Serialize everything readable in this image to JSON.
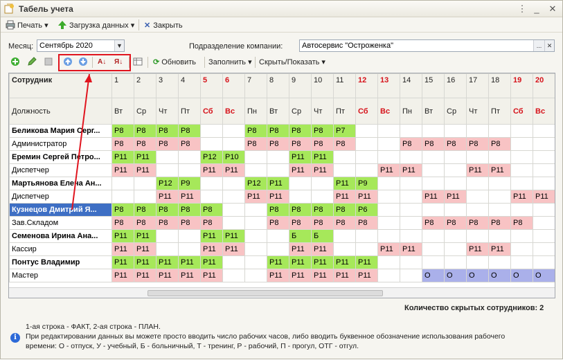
{
  "window": {
    "title": "Табель учета"
  },
  "toolbar": {
    "print": "Печать",
    "load": "Загрузка данных",
    "close": "Закрыть"
  },
  "filters": {
    "month_label": "Месяц:",
    "month_value": "Сентябрь 2020",
    "division_label": "Подразделение компании:",
    "division_value": "Автосервис \"Остроженка\""
  },
  "actions": {
    "refresh": "Обновить",
    "fill": "Заполнить",
    "hide_show": "Скрыть/Показать"
  },
  "grid": {
    "col_employee": "Сотрудник",
    "col_position": "Должность",
    "days": [
      {
        "n": "1",
        "d": "Вт",
        "we": false
      },
      {
        "n": "2",
        "d": "Ср",
        "we": false
      },
      {
        "n": "3",
        "d": "Чт",
        "we": false
      },
      {
        "n": "4",
        "d": "Пт",
        "we": false
      },
      {
        "n": "5",
        "d": "Сб",
        "we": true
      },
      {
        "n": "6",
        "d": "Вс",
        "we": true
      },
      {
        "n": "7",
        "d": "Пн",
        "we": false
      },
      {
        "n": "8",
        "d": "Вт",
        "we": false
      },
      {
        "n": "9",
        "d": "Ср",
        "we": false
      },
      {
        "n": "10",
        "d": "Чт",
        "we": false
      },
      {
        "n": "11",
        "d": "Пт",
        "we": false
      },
      {
        "n": "12",
        "d": "Сб",
        "we": true
      },
      {
        "n": "13",
        "d": "Вс",
        "we": true
      },
      {
        "n": "14",
        "d": "Пн",
        "we": false
      },
      {
        "n": "15",
        "d": "Вт",
        "we": false
      },
      {
        "n": "16",
        "d": "Ср",
        "we": false
      },
      {
        "n": "17",
        "d": "Чт",
        "we": false
      },
      {
        "n": "18",
        "d": "Пт",
        "we": false
      },
      {
        "n": "19",
        "d": "Сб",
        "we": true
      },
      {
        "n": "20",
        "d": "Вс",
        "we": true
      }
    ],
    "employees": [
      {
        "name": "Беликова Мария Серг...",
        "position": "Администратор",
        "selected": false,
        "fact": [
          "Р8",
          "Р8",
          "Р8",
          "Р8",
          "",
          "",
          "Р8",
          "Р8",
          "Р8",
          "Р8",
          "Р7",
          "",
          "",
          "",
          "",
          "",
          "",
          "",
          "",
          ""
        ],
        "plan": [
          "Р8",
          "Р8",
          "Р8",
          "Р8",
          "",
          "",
          "Р8",
          "Р8",
          "Р8",
          "Р8",
          "Р8",
          "",
          "",
          "Р8",
          "Р8",
          "Р8",
          "Р8",
          "Р8",
          "",
          ""
        ]
      },
      {
        "name": "Еремин Сергей Петро...",
        "position": "Диспетчер",
        "selected": false,
        "fact": [
          "Р11",
          "Р11",
          "",
          "",
          "Р12",
          "Р10",
          "",
          "",
          "Р11",
          "Р11",
          "",
          "",
          "",
          "",
          "",
          "",
          "",
          "",
          "",
          ""
        ],
        "plan": [
          "Р11",
          "Р11",
          "",
          "",
          "Р11",
          "Р11",
          "",
          "",
          "Р11",
          "Р11",
          "",
          "",
          "Р11",
          "Р11",
          "",
          "",
          "Р11",
          "Р11",
          "",
          ""
        ]
      },
      {
        "name": "Мартьянова Елена Ан...",
        "position": "Диспетчер",
        "selected": false,
        "fact": [
          "",
          "",
          "Р12",
          "Р9",
          "",
          "",
          "Р12",
          "Р11",
          "",
          "",
          "Р11",
          "Р9",
          "",
          "",
          "",
          "",
          "",
          "",
          "",
          ""
        ],
        "plan": [
          "",
          "",
          "Р11",
          "Р11",
          "",
          "",
          "Р11",
          "Р11",
          "",
          "",
          "Р11",
          "Р11",
          "",
          "",
          "Р11",
          "Р11",
          "",
          "",
          "Р11",
          "Р11"
        ]
      },
      {
        "name": "Кузнецов Дмитрий Я...",
        "position": "Зав.Складом",
        "selected": true,
        "fact": [
          "Р8",
          "Р8",
          "Р8",
          "Р8",
          "Р8",
          "",
          "",
          "Р8",
          "Р8",
          "Р8",
          "Р8",
          "Р6",
          "",
          "",
          "",
          "",
          "",
          "",
          "",
          ""
        ],
        "plan": [
          "Р8",
          "Р8",
          "Р8",
          "Р8",
          "Р8",
          "",
          "",
          "Р8",
          "Р8",
          "Р8",
          "Р8",
          "Р8",
          "",
          "",
          "Р8",
          "Р8",
          "Р8",
          "Р8",
          "Р8",
          ""
        ]
      },
      {
        "name": "Семенова Ирина Ана...",
        "position": "Кассир",
        "selected": false,
        "fact": [
          "Р11",
          "Р11",
          "",
          "",
          "Р11",
          "Р11",
          "",
          "",
          "Б",
          "Б",
          "",
          "",
          "",
          "",
          "",
          "",
          "",
          "",
          "",
          ""
        ],
        "plan": [
          "Р11",
          "Р11",
          "",
          "",
          "Р11",
          "Р11",
          "",
          "",
          "Р11",
          "Р11",
          "",
          "",
          "Р11",
          "Р11",
          "",
          "",
          "Р11",
          "Р11",
          "",
          ""
        ]
      },
      {
        "name": "Понтус Владимир",
        "position": "Мастер",
        "selected": false,
        "fact": [
          "Р11",
          "Р11",
          "Р11",
          "Р11",
          "Р11",
          "",
          "",
          "Р11",
          "Р11",
          "Р11",
          "Р11",
          "Р11",
          "",
          "",
          "",
          "",
          "",
          "",
          "",
          ""
        ],
        "plan": [
          "Р11",
          "Р11",
          "Р11",
          "Р11",
          "Р11",
          "",
          "",
          "Р11",
          "Р11",
          "Р11",
          "Р11",
          "Р11",
          "",
          "",
          "О",
          "О",
          "О",
          "О",
          "О",
          "О"
        ]
      }
    ]
  },
  "hidden_count": "Количество скрытых сотрудников: 2",
  "notes": {
    "line1": "1-ая строка - ФАКТ, 2-ая строка - ПЛАН.",
    "line2": "При редактировании данных вы можете просто вводить число рабочих часов, либо вводить буквенное обозначение использования рабочего",
    "line3": "времени: О - отпуск, У - учебный, Б - больничный, Т - тренинг, Р - рабочий, П - прогул, ОТГ - отгул."
  },
  "colors": {
    "fact": "#a6e85a",
    "plan": "#f8c3c4",
    "vacation": "#aab0ea",
    "weekend_text": "#d6121a",
    "highlight": "#e0141e"
  }
}
